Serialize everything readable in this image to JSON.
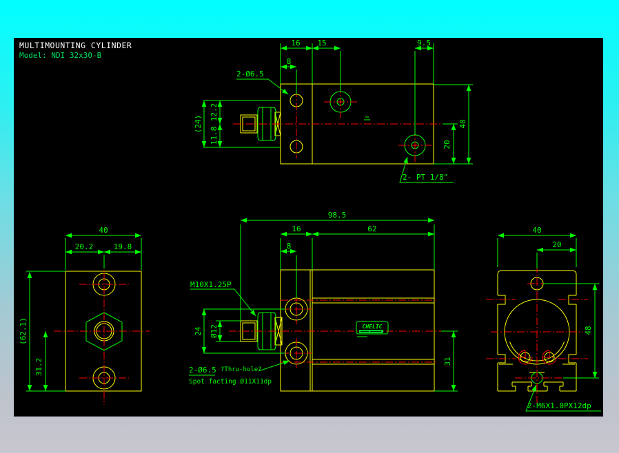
{
  "title_block": {
    "title": "MULTIMOUNTING CYLINDER",
    "model": "Model: NDI 32x30-B"
  },
  "colors": {
    "background_top": "#00ffff",
    "background_bottom": "#c8c6ce",
    "canvas": "#000000",
    "outline": "#ffff00",
    "annotation": "#00ff00",
    "centerline": "#ff0000",
    "title_text": "#ffffff"
  },
  "top_view": {
    "dim_16": "16",
    "dim_15": "15",
    "dim_9_5": "9.5",
    "dim_8": "8",
    "dim_24_ref": "(24)",
    "dim_12_2": "12.2",
    "dim_11_8": "11.8",
    "dim_40": "40",
    "dim_20": "20",
    "callout_holes": "2-Ø6.5",
    "callout_ports": "2- PT 1/8\""
  },
  "front_view": {
    "dim_40": "40",
    "dim_20_2": "20.2",
    "dim_19_8": "19.8",
    "dim_62_1_ref": "(62.1)",
    "dim_31_2": "31.2"
  },
  "side_view": {
    "dim_98_5": "98.5",
    "dim_16": "16",
    "dim_62": "62",
    "dim_8": "8",
    "dim_24": "24",
    "dim_dia12": "Ø12",
    "dim_31": "31",
    "callout_thread": "M10X1.25P",
    "callout_thru_hole": "2-Ø6.5",
    "callout_thru_hole_note": "?Thru-hole?",
    "callout_spotface": "Spot facting  Ø11X11dp",
    "logo_text": "CHELIC"
  },
  "end_view": {
    "dim_40": "40",
    "dim_20": "20",
    "dim_48": "48",
    "callout_tap": "2-M6X1.0PX12dp"
  }
}
